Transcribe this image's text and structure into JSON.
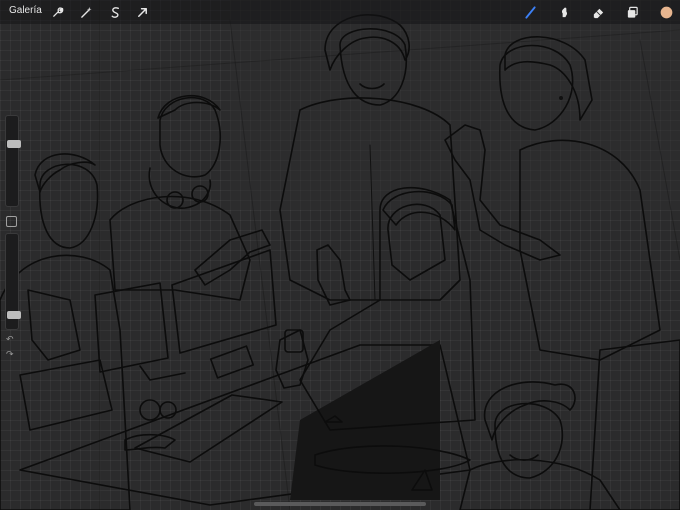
{
  "app": {
    "gallery_label": "Galería"
  },
  "toolbar": {
    "left_tools": [
      {
        "name": "wrench-icon"
      },
      {
        "name": "magic-wand-icon"
      },
      {
        "name": "selection-icon"
      },
      {
        "name": "transform-arrow-icon"
      }
    ],
    "right_tools": [
      {
        "name": "brush-icon",
        "active": true
      },
      {
        "name": "smudge-icon"
      },
      {
        "name": "eraser-icon"
      },
      {
        "name": "layers-icon"
      }
    ],
    "color_swatch": "#e7b58f"
  },
  "sidebar": {
    "size_level": 0.7,
    "opacity_level": 0.1,
    "undo_icon": "undo-icon",
    "redo_icon": "redo-icon"
  },
  "colors": {
    "accent": "#3c80f6",
    "canvas": "#2b2b2c",
    "skin_light": "#e7b58f",
    "skin_dark": "#3a2420"
  }
}
